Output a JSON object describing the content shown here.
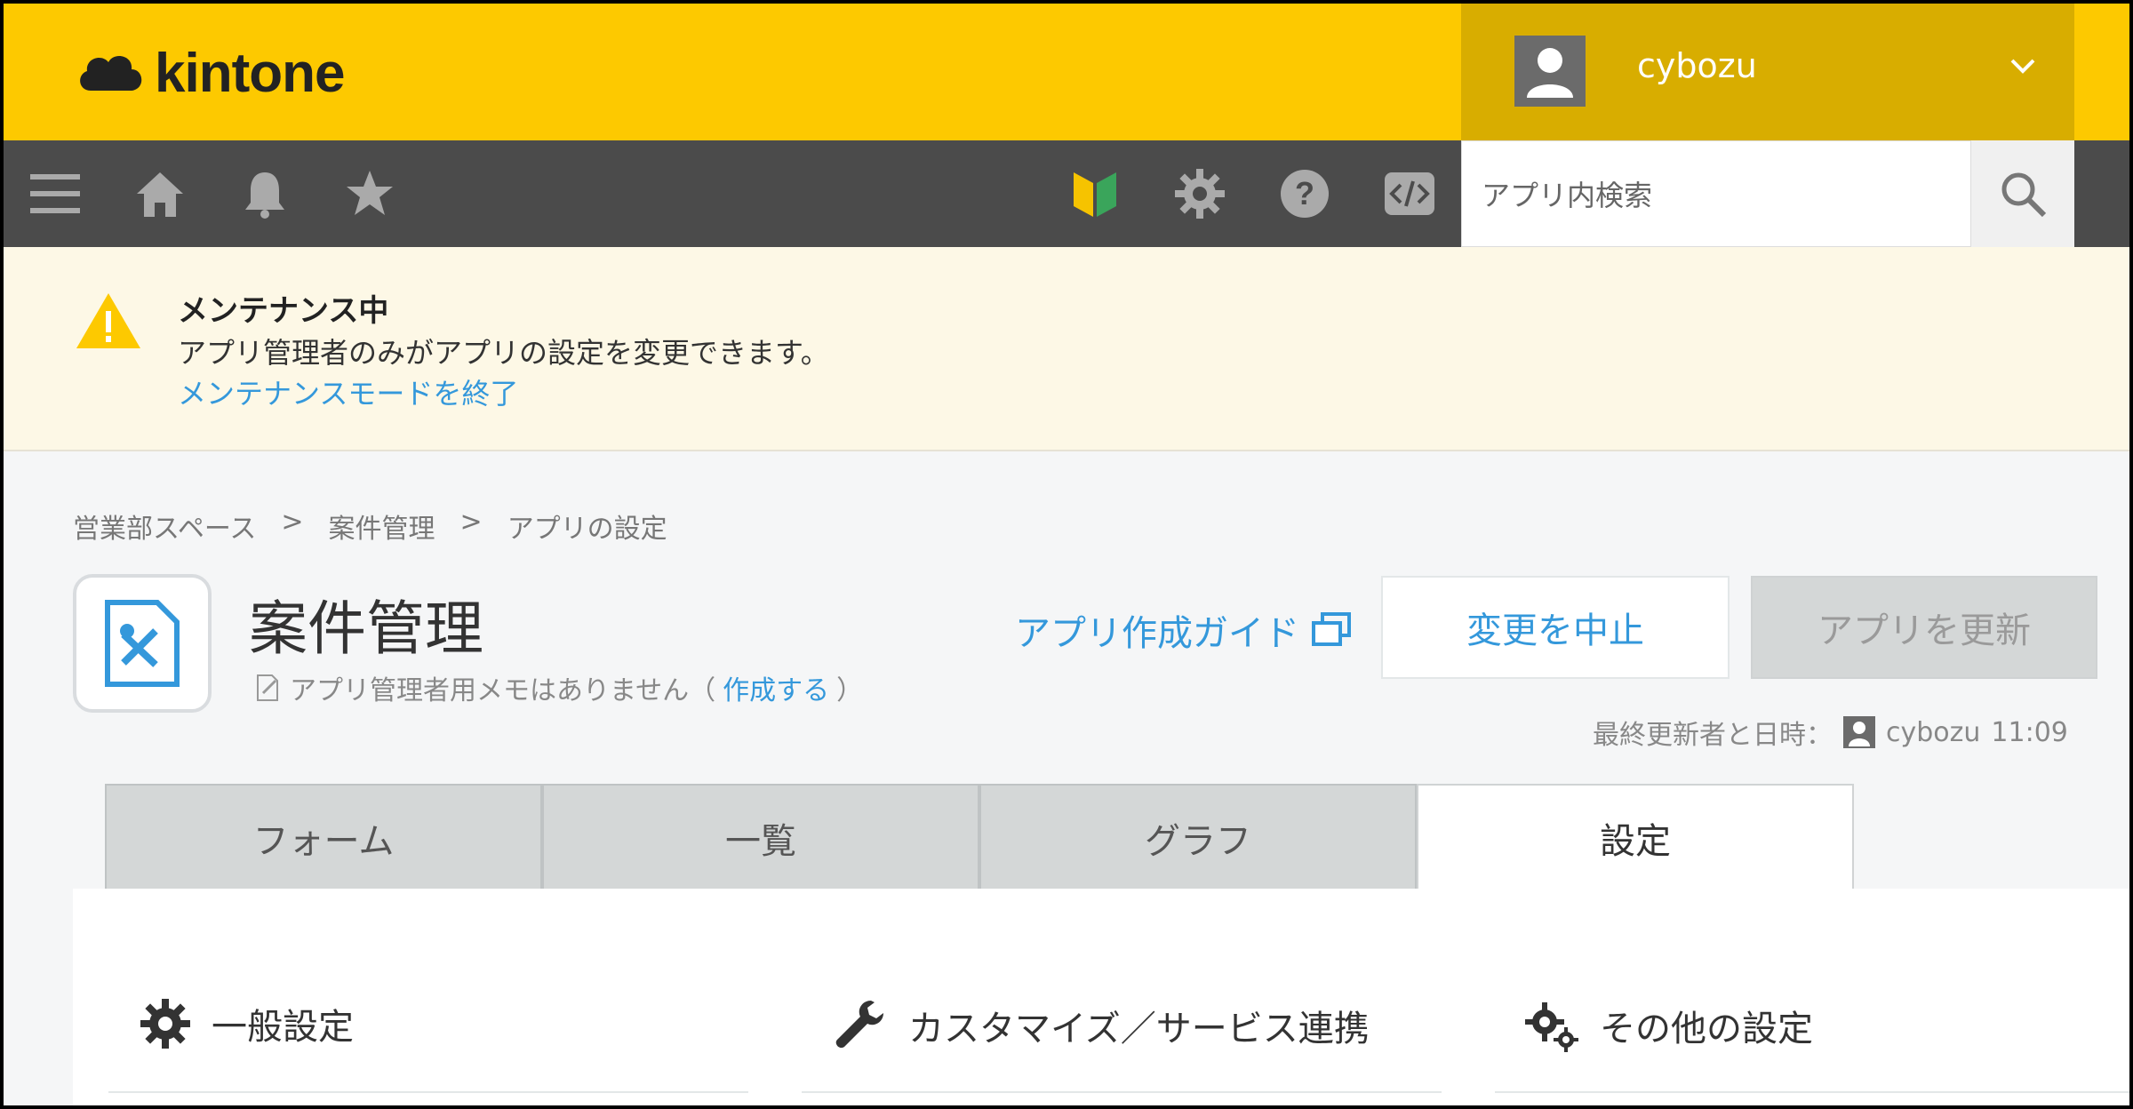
{
  "header": {
    "logo_text": "kintone",
    "user_name": "cybozu",
    "brand_color": "#fdc900"
  },
  "toolbar": {
    "icons": [
      "menu-icon",
      "home-icon",
      "bell-icon",
      "star-icon",
      "beginner-icon",
      "gear-icon",
      "help-icon",
      "code-icon"
    ],
    "search_placeholder": "アプリ内検索"
  },
  "notice": {
    "title": "メンテナンス中",
    "body": "アプリ管理者のみがアプリの設定を変更できます。",
    "link": "メンテナンスモードを終了"
  },
  "breadcrumb": [
    "営業部スペース",
    ">",
    "案件管理",
    ">",
    "アプリの設定"
  ],
  "app": {
    "title": "案件管理",
    "memo_text": "アプリ管理者用メモはありません（",
    "memo_link": "作成する",
    "memo_close": "）"
  },
  "actions": {
    "guide": "アプリ作成ガイド",
    "cancel": "変更を中止",
    "update": "アプリを更新"
  },
  "last_updated": {
    "label": "最終更新者と日時：",
    "user": "cybozu",
    "time": "11:09"
  },
  "tabs": [
    "フォーム",
    "一覧",
    "グラフ",
    "設定"
  ],
  "sections": [
    "一般設定",
    "カスタマイズ／サービス連携",
    "その他の設定"
  ]
}
